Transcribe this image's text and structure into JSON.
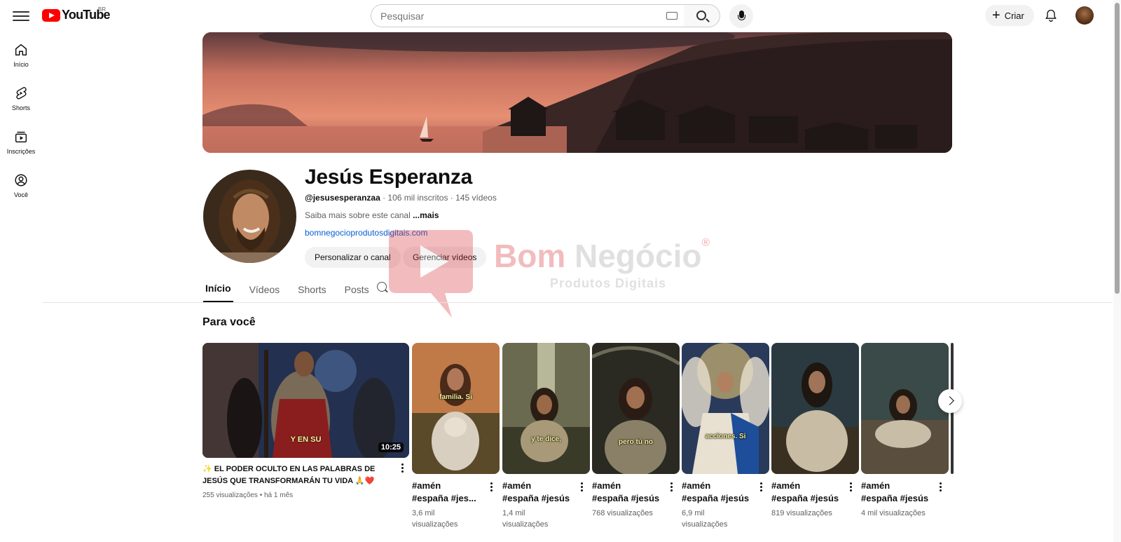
{
  "header": {
    "logo_text": "YouTube",
    "region": "BR",
    "search_placeholder": "Pesquisar",
    "create_label": "Criar"
  },
  "rail": [
    {
      "label": "Início",
      "icon": "home-icon"
    },
    {
      "label": "Shorts",
      "icon": "shorts-icon"
    },
    {
      "label": "Inscrições",
      "icon": "subscriptions-icon"
    },
    {
      "label": "Você",
      "icon": "you-icon"
    }
  ],
  "channel": {
    "name": "Jesús Esperanza",
    "handle": "@jesusesperanzaa",
    "subscribers": " · 106 mil inscritos · 145 vídeos",
    "description": "Saiba mais sobre este canal ",
    "more": "...mais",
    "link": "bomnegocioprodutosdigitais.com",
    "customize_label": "Personalizar o canal",
    "manage_label": "Gerenciar vídeos"
  },
  "watermark": {
    "brand_a": "Bom ",
    "brand_b": "Negócio",
    "mark": "®",
    "subtitle": "Produtos Digitais"
  },
  "tabs": [
    "Início",
    "Vídeos",
    "Shorts",
    "Posts"
  ],
  "section_title": "Para você",
  "featured": {
    "caption": "Y EN SU",
    "duration": "10:25",
    "title": "✨ EL PODER OCULTO EN LAS PALABRAS DE JESÚS QUE TRANSFORMARÁN TU VIDA 🙏❤️",
    "meta": "255 visualizações • há 1 mês"
  },
  "shorts": [
    {
      "caption": "familia. Si",
      "title_1": "#amén",
      "title_2": "#españa #jes...",
      "views": "3,6 mil visualizações"
    },
    {
      "caption": "y te dice,",
      "title_1": "#amén",
      "title_2": "#españa #jesús",
      "views": "1,4 mil visualizações"
    },
    {
      "caption": "pero tú no",
      "title_1": "#amén",
      "title_2": "#españa #jesús",
      "views": "768 visualizações"
    },
    {
      "caption": "acciones. Si",
      "title_1": "#amén",
      "title_2": "#españa #jesús",
      "views": "6,9 mil visualizações"
    },
    {
      "caption": "",
      "title_1": "#amén",
      "title_2": "#españa #jesús",
      "views": "819 visualizações"
    },
    {
      "caption": "",
      "title_1": "#amén",
      "title_2": "#españa #jesús",
      "views": "4 mil visualizações"
    }
  ]
}
